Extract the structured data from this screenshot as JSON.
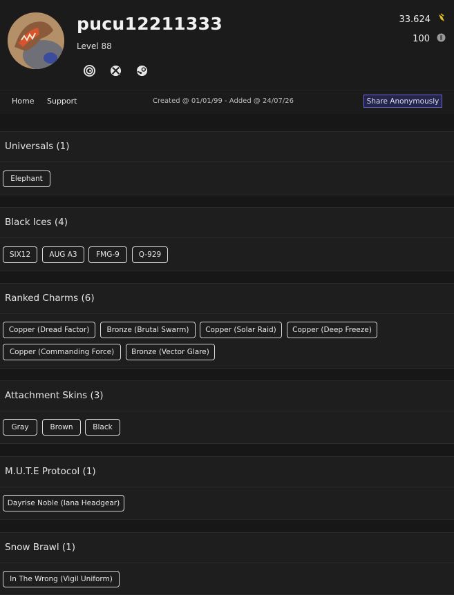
{
  "profile": {
    "username": "pucu12211333",
    "level": "Level 88"
  },
  "platforms": [
    "ubisoft-icon",
    "xbox-icon",
    "steam-icon"
  ],
  "currency": {
    "credits": "33.624",
    "credits_icon": "renown-icon",
    "other": "100",
    "other_icon": "coin-icon"
  },
  "nav": {
    "home": "Home",
    "support": "Support",
    "meta": "Created @ 01/01/99 - Added @ 24/07/26",
    "share": "Share Anonymously"
  },
  "sections": [
    {
      "title": "Universals (1)",
      "items": [
        "Elephant"
      ]
    },
    {
      "title": "Black Ices (4)",
      "items": [
        "SIX12",
        "AUG A3",
        "FMG-9",
        "Q-929"
      ]
    },
    {
      "title": "Ranked Charms (6)",
      "items": [
        "Copper (Dread Factor)",
        "Bronze (Brutal Swarm)",
        "Copper (Solar Raid)",
        "Copper (Deep Freeze)",
        "Copper (Commanding Force)",
        "Bronze (Vector Glare)"
      ]
    },
    {
      "title": "Attachment Skins (3)",
      "items": [
        "Gray",
        "Brown",
        "Black"
      ]
    },
    {
      "title": "M.U.T.E Protocol (1)",
      "items": [
        "Dayrise Noble (Iana Headgear)"
      ]
    },
    {
      "title": "Snow Brawl (1)",
      "items": [
        "In The Wrong (Vigil Uniform)"
      ]
    }
  ],
  "colors": {
    "background": "#171717",
    "panel": "#1e1e1e",
    "accent": "#6a6ad8",
    "renown": "#e8c21a"
  }
}
